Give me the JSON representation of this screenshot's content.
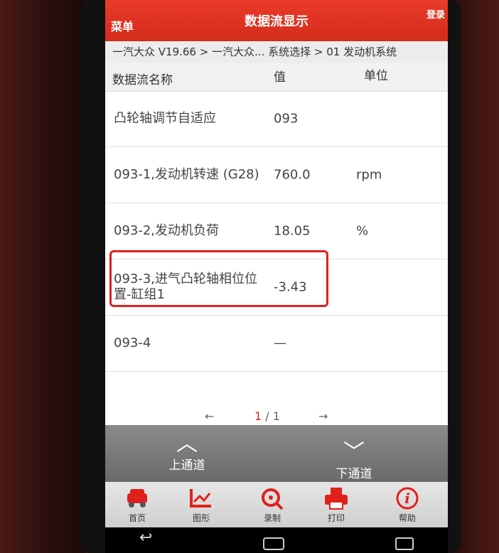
{
  "titlebar": {
    "menu": "菜单",
    "title": "数据流显示",
    "login": "登录"
  },
  "breadcrumb": "一汽大众 V19.66 > 一汽大众... 系统选择 > 01 发动机系统",
  "table": {
    "headers": {
      "name": "数据流名称",
      "value": "值",
      "unit": "单位"
    },
    "rows": [
      {
        "name": "凸轮轴调节自适应",
        "value": "093",
        "unit": ""
      },
      {
        "name": "093-1,发动机转速 (G28)",
        "value": "760.0",
        "unit": "rpm"
      },
      {
        "name": "093-2,发动机负荷",
        "value": "18.05",
        "unit": "%"
      },
      {
        "name": "093-3,进气凸轮轴相位位置-缸组1",
        "value": "-3.43",
        "unit": ""
      },
      {
        "name": "093-4",
        "value": "—",
        "unit": ""
      }
    ]
  },
  "pager": {
    "prev": "←",
    "current": "1",
    "sep": "/",
    "total": "1",
    "next": "→"
  },
  "nav": {
    "up_icon": "chevron-up-icon",
    "up_label": "上通道",
    "down_icon": "chevron-down-icon",
    "down_label": "下通道"
  },
  "toolbar": [
    {
      "label": "首页",
      "icon": "car-home-icon"
    },
    {
      "label": "图形",
      "icon": "graph-icon"
    },
    {
      "label": "录制",
      "icon": "record-icon"
    },
    {
      "label": "打印",
      "icon": "printer-icon"
    },
    {
      "label": "帮助",
      "icon": "help-icon"
    }
  ],
  "colors": {
    "accent": "#d42b1b",
    "highlight": "#e0201c"
  }
}
